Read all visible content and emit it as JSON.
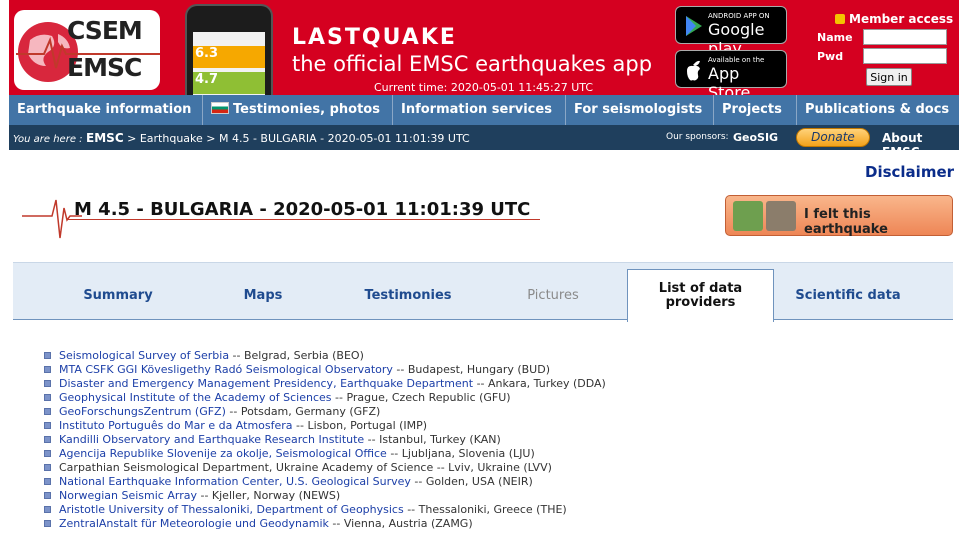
{
  "banner": {
    "logo_line1": "CSEM",
    "logo_line2": "EMSC",
    "app_name": "LASTQUAKE",
    "app_tagline": "the official EMSC earthquakes app",
    "current_time": "Current time: 2020-05-01 11:45:27 UTC",
    "google_play_small": "ANDROID APP ON",
    "google_play_big": "Google play",
    "app_store_small": "Available on the",
    "app_store_big": "App Store",
    "phone_mag_1": "6.3",
    "phone_mag_2": "4.7",
    "member_access": "Member access",
    "name_label": "Name",
    "pwd_label": "Pwd",
    "sign_in": "Sign in"
  },
  "nav": {
    "items": [
      "Earthquake information",
      "Testimonies, photos",
      "Information services",
      "For seismologists",
      "Projects",
      "Publications & docs"
    ]
  },
  "crumbs": {
    "you_are_here": "You are here :",
    "root": "EMSC",
    "path": " > Earthquake > M 4.5 - BULGARIA - 2020-05-01 11:01:39 UTC",
    "sponsors_label": "Our sponsors:",
    "sponsor": "GeoSIG",
    "donate": "Donate",
    "about": "About EMSC"
  },
  "page": {
    "disclaimer": "Disclaimer",
    "title": "M 4.5 - BULGARIA - 2020-05-01 11:01:39 UTC",
    "felt": "I felt this earthquake"
  },
  "tabs": {
    "summary": "Summary",
    "maps": "Maps",
    "testimonies": "Testimonies",
    "pictures": "Pictures",
    "providers": "List of data providers",
    "scientific": "Scientific data"
  },
  "providers": [
    {
      "name": "Seismological Survey of Serbia",
      "loc": " -- Belgrad, Serbia (BEO)"
    },
    {
      "name": "MTA CSFK GGI Kövesligethy Radó Seismological Observatory",
      "loc": " -- Budapest, Hungary (BUD)"
    },
    {
      "name": "Disaster and Emergency Management Presidency, Earthquake Department",
      "loc": " -- Ankara, Turkey (DDA)"
    },
    {
      "name": "Geophysical Institute of the Academy of Sciences",
      "loc": " -- Prague, Czech Republic (GFU)"
    },
    {
      "name": "GeoForschungsZentrum (GFZ)",
      "loc": " -- Potsdam, Germany (GFZ)"
    },
    {
      "name": "Instituto Português do Mar e da Atmosfera",
      "loc": " -- Lisbon, Portugal (IMP)"
    },
    {
      "name": "Kandilli Observatory and Earthquake Research Institute",
      "loc": " -- Istanbul, Turkey (KAN)"
    },
    {
      "name": "Agencija Republike Slovenije za okolje, Seismological Office",
      "loc": " -- Ljubljana, Slovenia (LJU)"
    },
    {
      "name": "",
      "plain": "Carpathian Seismological Department, Ukraine Academy of Science -- Lviv, Ukraine (LVV)"
    },
    {
      "name": "National Earthquake Information Center, U.S. Geological Survey",
      "loc": " -- Golden, USA (NEIR)"
    },
    {
      "name": "Norwegian Seismic Array",
      "loc": " -- Kjeller, Norway (NEWS)"
    },
    {
      "name": "Aristotle University of Thessaloniki, Department of Geophysics",
      "loc": " -- Thessaloniki, Greece (THE)"
    },
    {
      "name": "ZentralAnstalt für Meteorologie und Geodynamik",
      "loc": " -- Vienna, Austria (ZAMG)"
    }
  ]
}
